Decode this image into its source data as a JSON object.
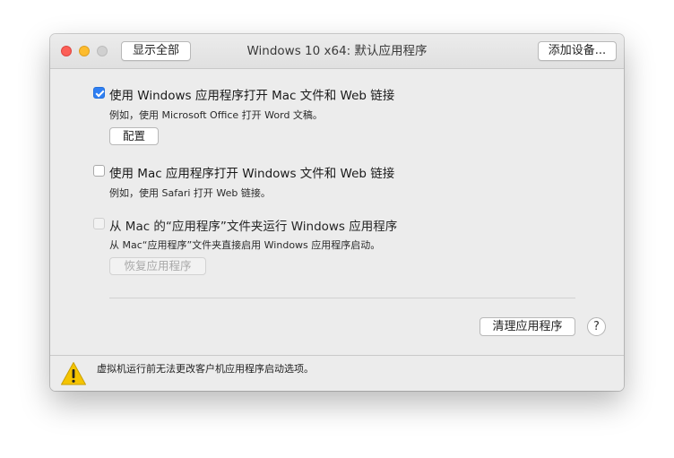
{
  "window": {
    "title": "Windows 10 x64: 默认应用程序",
    "show_all_label": "显示全部",
    "add_device_label": "添加设备..."
  },
  "options": [
    {
      "label": "使用 Windows 应用程序打开 Mac 文件和 Web 链接",
      "description": "例如，使用 Microsoft Office 打开 Word 文稿。",
      "checked": true,
      "enabled": true,
      "button_label": "配置"
    },
    {
      "label": "使用 Mac 应用程序打开 Windows 文件和 Web 链接",
      "description": "例如，使用 Safari 打开 Web 链接。",
      "checked": false,
      "enabled": true
    },
    {
      "label": "从 Mac 的“应用程序”文件夹运行 Windows 应用程序",
      "description": "从 Mac“应用程序”文件夹直接启用 Windows 应用程序启动。",
      "checked": false,
      "enabled": false,
      "button_label": "恢复应用程序"
    }
  ],
  "actions": {
    "clean_label": "清理应用程序",
    "help_label": "?"
  },
  "footer": {
    "message": "虚拟机运行前无法更改客户机应用程序启动选项。",
    "icon": "warning-icon"
  },
  "colors": {
    "accent": "#2f7ff3",
    "close": "#fc5f57",
    "minimize": "#fdbc2e",
    "warning": "#f5c400"
  }
}
